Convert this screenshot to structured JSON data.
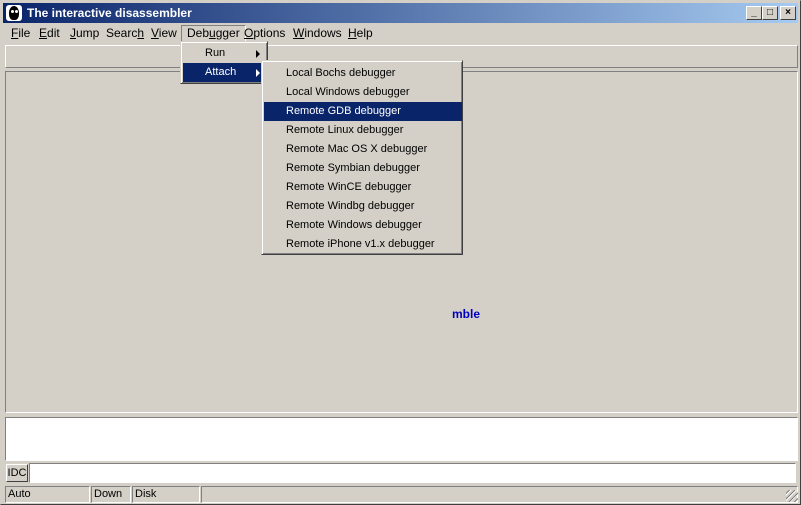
{
  "window": {
    "title": "The interactive disassembler",
    "minimize": "_",
    "maximize": "□",
    "close": "×"
  },
  "menubar": {
    "items": [
      {
        "pre": "",
        "key": "F",
        "post": "ile"
      },
      {
        "pre": "",
        "key": "E",
        "post": "dit"
      },
      {
        "pre": "",
        "key": "J",
        "post": "ump"
      },
      {
        "pre": "Searc",
        "key": "h",
        "post": ""
      },
      {
        "pre": "",
        "key": "V",
        "post": "iew"
      },
      {
        "pre": "Deb",
        "key": "u",
        "post": "gger"
      },
      {
        "pre": "",
        "key": "O",
        "post": "ptions"
      },
      {
        "pre": "",
        "key": "W",
        "post": "indows"
      },
      {
        "pre": "",
        "key": "H",
        "post": "elp"
      }
    ]
  },
  "debugger_menu": {
    "items": [
      "Run",
      "Attach"
    ],
    "highlighted": "Attach"
  },
  "attach_menu": {
    "items": [
      "Local Bochs debugger",
      "Local Windows debugger",
      "Remote GDB debugger",
      "Remote Linux debugger",
      "Remote Mac OS X debugger",
      "Remote Symbian debugger",
      "Remote WinCE debugger",
      "Remote Windbg debugger",
      "Remote Windows debugger",
      "Remote iPhone v1.x debugger"
    ],
    "highlighted": "Remote GDB debugger"
  },
  "workspace": {
    "hint_text": "mble"
  },
  "command_line": {
    "label": "IDC",
    "value": ""
  },
  "statusbar": {
    "cells": [
      "Auto",
      "Down",
      "Disk",
      ""
    ]
  },
  "colors": {
    "title_start": "#0a246a",
    "title_end": "#a6caf0",
    "highlight": "#0a246a",
    "hint_text": "#0000c0",
    "face": "#d4d0c8"
  },
  "icons": {
    "app": "ida-app-icon",
    "submenu": "submenu-arrow-icon"
  }
}
